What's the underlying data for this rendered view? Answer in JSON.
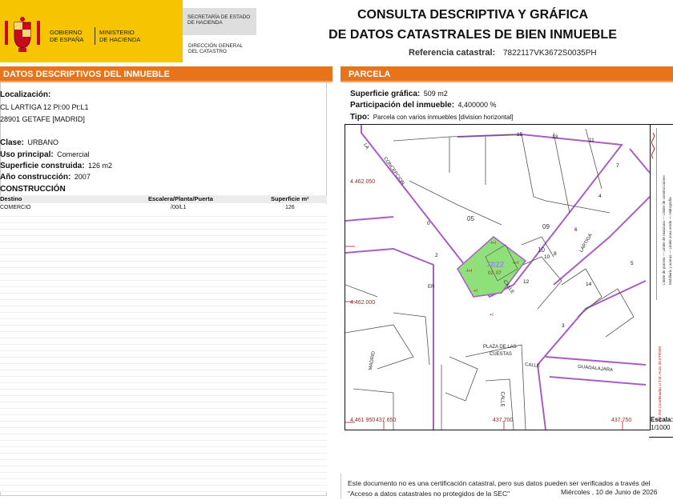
{
  "header": {
    "gov_line1": "GOBIERNO",
    "gov_line2": "DE ESPAÑA",
    "min_line1": "MINISTERIO",
    "min_line2": "DE HACIENDA",
    "sec_line1": "SECRETARÍA DE ESTADO",
    "sec_line2": "DE HACIENDA",
    "dir_line1": "DIRECCIÓN GENERAL",
    "dir_line2": "DEL CATASTRO",
    "title_line1": "CONSULTA DESCRIPTIVA Y GRÁFICA",
    "title_line2": "DE DATOS CATASTRALES DE BIEN INMUEBLE",
    "ref_label": "Referencia catastral:",
    "ref_value": "7822117VK3672S0035PH"
  },
  "left": {
    "section_title": "DATOS DESCRIPTIVOS DEL INMUEBLE",
    "localizacion_label": "Localización:",
    "address_line1": "CL LARTIGA 12 Pl:00 Pt:L1",
    "address_line2": "28901 GETAFE [MADRID]",
    "clase_label": "Clase:",
    "clase_value": "URBANO",
    "uso_label": "Uso principal:",
    "uso_value": "Comercial",
    "superficie_label": "Superficie construida:",
    "superficie_value": "126 m2",
    "anio_label": "Año construcción:",
    "anio_value": "2007",
    "construccion_title": "CONSTRUCCIÓN",
    "table": {
      "headers": [
        "Destino",
        "Escalera/Planta/Puerta",
        "Superficie m²"
      ],
      "rows": [
        [
          "COMERCIO",
          "/00/L1",
          "126"
        ]
      ]
    }
  },
  "right": {
    "section_title": "PARCELA",
    "sup_grafica_label": "Superficie gráfica:",
    "sup_grafica_value": "509 m2",
    "participacion_label": "Participación del inmueble:",
    "participacion_value": "4,400000 %",
    "tipo_label": "Tipo:",
    "tipo_value": "Parcela con varios inmuebles [division horizontal]"
  },
  "map": {
    "coords": {
      "y1": "4.462.050",
      "y2": "4.462.000",
      "y3": "4.461 950",
      "x1": "437.650",
      "x2": "437.700",
      "x3": "437.750"
    },
    "parcel_labels": [
      "05",
      "09",
      "10",
      "7822",
      "02",
      "07"
    ],
    "street_labels": [
      "CALLE",
      "LARTIGA",
      "CALLE",
      "GUADALAJARA",
      "PLAZA DE LAS",
      "CUESTAS",
      "CALLE",
      "ER",
      "LA",
      "CONCEPCION",
      "MADRID"
    ],
    "building_codes": [
      "-I+I",
      "-I+I",
      "-I+I",
      "+I",
      "+I"
    ],
    "house_numbers": [
      "15",
      "13",
      "11",
      "7",
      "5",
      "3",
      "4",
      "6",
      "8",
      "10",
      "12",
      "14",
      "0",
      "2"
    ]
  },
  "legend": {
    "items": [
      "Límite de parcela",
      "Límite de manzana",
      "Límite de construcciones",
      "Mobiliario y aceras",
      "Límite zona verde",
      "Hidrografía"
    ],
    "coords_note": "437.750 Coordenadas U.T.M. Huso 30 ETRS89",
    "scale_label": "Escala:",
    "scale_value": "1/1000"
  },
  "footer": {
    "note": "Este documento no es una certificación catastral, pero sus datos pueden ser verificados a través del \"Acceso a datos catastrales no protegidos de la SEC\"",
    "date": "Miércoles , 10 de Junio de 2026"
  },
  "colors": {
    "orange": "#e8731a",
    "yellow": "#f6c400",
    "parcel_line": "#a85dc7",
    "parcel_fill": "#8fe07a",
    "coord_text": "#b21b1b"
  }
}
